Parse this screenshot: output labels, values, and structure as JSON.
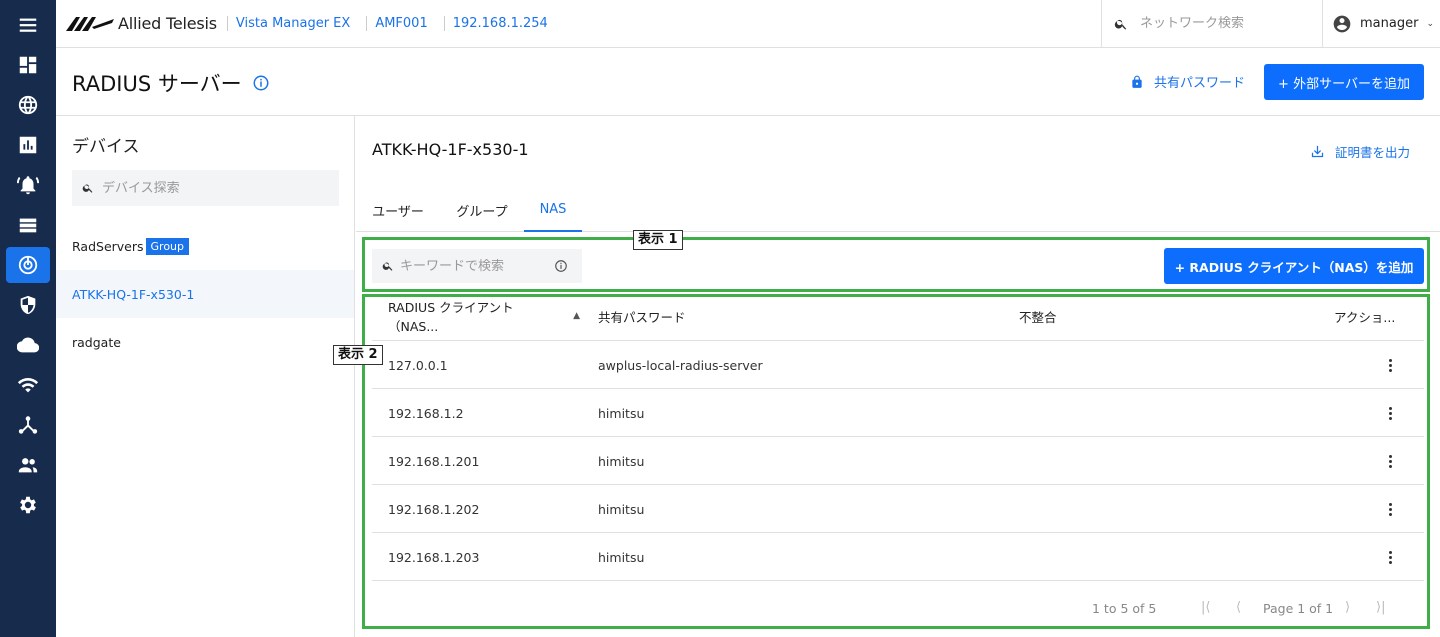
{
  "rail": {
    "items": [
      "menu-icon",
      "dashboard-icon",
      "globe-icon",
      "report-icon",
      "alarm-icon",
      "list-icon",
      "radius-icon",
      "shield-icon",
      "cloud-icon",
      "wifi-icon",
      "topology-icon",
      "users-icon",
      "gear-icon"
    ],
    "active": "radius-icon"
  },
  "header": {
    "brand": "Allied Telesis",
    "breadcrumbs": [
      "Vista Manager EX",
      "AMF001",
      "192.168.1.254"
    ],
    "search_placeholder": "ネットワーク検索",
    "user": "manager"
  },
  "page": {
    "title": "RADIUS サーバー",
    "shared_password_label": "共有パスワード",
    "add_external_label": "+ 外部サーバーを追加"
  },
  "devices": {
    "title": "デバイス",
    "search_placeholder": "デバイス探索",
    "items": [
      {
        "label": "RadServers",
        "badge": "Group"
      },
      {
        "label": "ATKK-HQ-1F-x530-1",
        "selected": true
      },
      {
        "label": "radgate"
      }
    ]
  },
  "main": {
    "device_name": "ATKK-HQ-1F-x530-1",
    "export_cert_label": "証明書を出力",
    "tabs": [
      {
        "label": "ユーザー"
      },
      {
        "label": "グループ"
      },
      {
        "label": "NAS",
        "active": true
      }
    ],
    "keyword_placeholder": "キーワードで検索",
    "add_nas_label": "+ RADIUS クライアント（NAS）を追加"
  },
  "annotations": {
    "box1_label": "表示 1",
    "box2_label": "表示 2"
  },
  "table": {
    "columns": [
      "RADIUS クライアント（NAS...",
      "共有パスワード",
      "不整合",
      "アクショ..."
    ],
    "rows": [
      {
        "client": "127.0.0.1",
        "password": "awplus-local-radius-server",
        "mismatch": ""
      },
      {
        "client": "192.168.1.2",
        "password": "himitsu",
        "mismatch": ""
      },
      {
        "client": "192.168.1.201",
        "password": "himitsu",
        "mismatch": ""
      },
      {
        "client": "192.168.1.202",
        "password": "himitsu",
        "mismatch": ""
      },
      {
        "client": "192.168.1.203",
        "password": "himitsu",
        "mismatch": ""
      }
    ]
  },
  "pager": {
    "range": "1 to 5 of 5",
    "page": "Page 1 of 1"
  },
  "colors": {
    "rail_bg": "#172b4d",
    "accent": "#1a73e8",
    "primary_button": "#0d6efd",
    "annotation": "#3fae49"
  }
}
